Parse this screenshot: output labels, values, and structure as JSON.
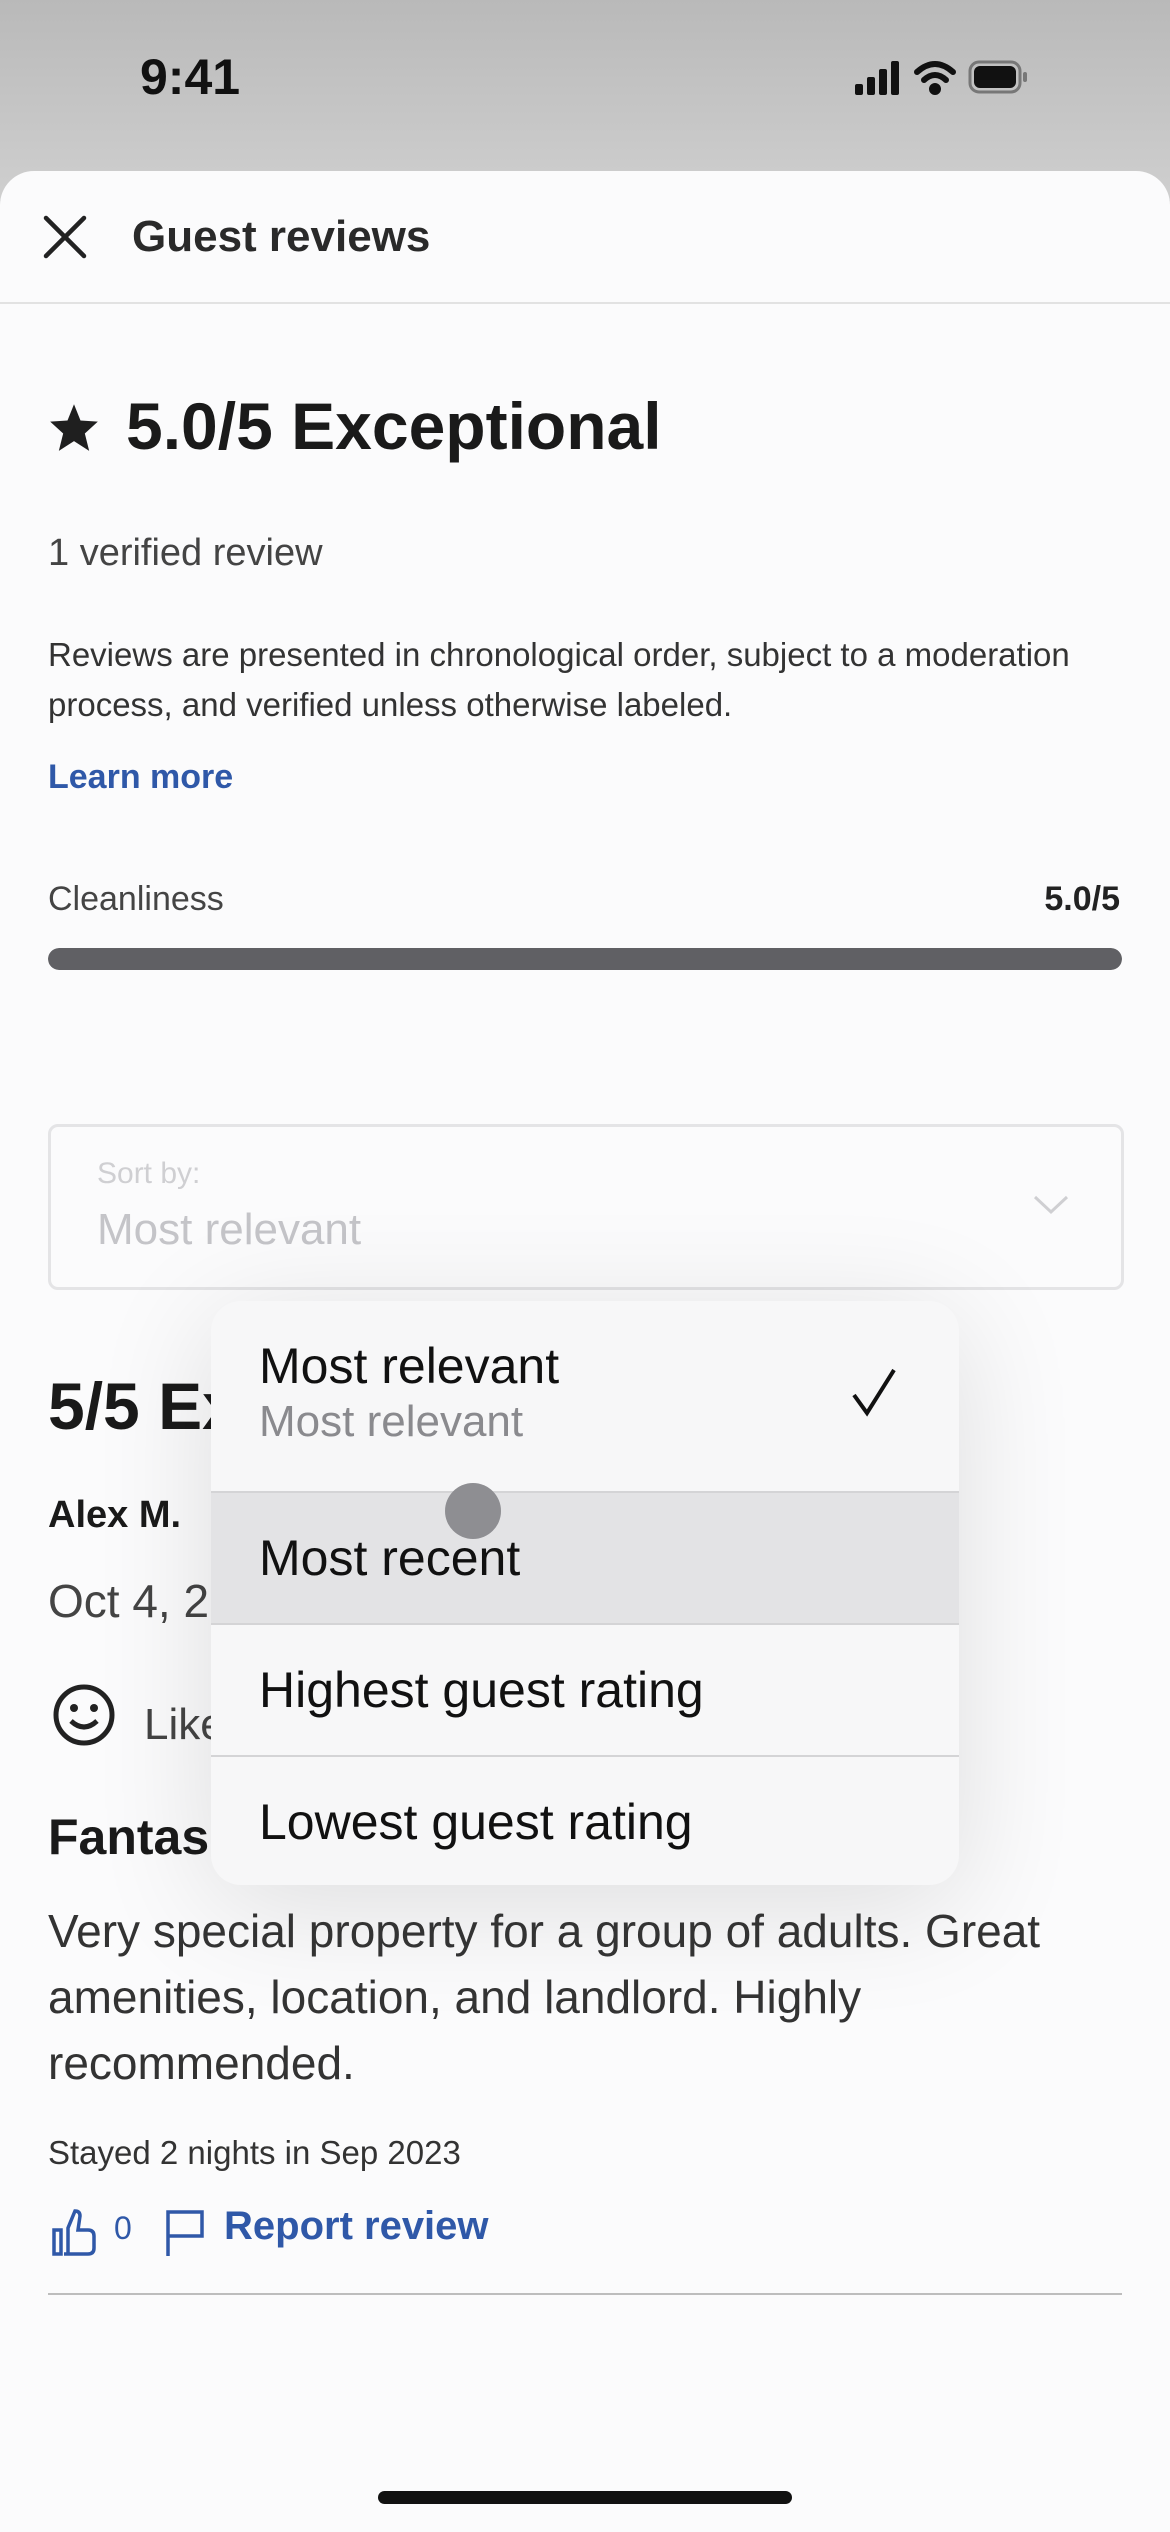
{
  "status_bar": {
    "time": "9:41"
  },
  "header": {
    "title": "Guest reviews",
    "close_icon": "close-icon"
  },
  "summary": {
    "rating_title": "5.0/5 Exceptional",
    "verified_count": "1 verified review",
    "disclaimer": "Reviews are presented in chronological order, subject to a moderation process, and verified unless otherwise labeled.",
    "learn_more": "Learn more",
    "categories": [
      {
        "label": "Cleanliness",
        "value": "5.0/5",
        "fraction": 1.0
      }
    ]
  },
  "sort": {
    "label": "Sort by:",
    "value": "Most relevant"
  },
  "sort_menu": {
    "items": [
      {
        "label": "Most relevant",
        "subtitle": "Most relevant",
        "selected": true
      },
      {
        "label": "Most recent",
        "highlighted": true
      },
      {
        "label": "Highest guest rating"
      },
      {
        "label": "Lowest guest rating"
      }
    ]
  },
  "review": {
    "rating_partial": "5/5 Ex",
    "author": "Alex M.",
    "date_partial": "Oct 4, 2",
    "liked_partial": "Like",
    "title_partial": "Fantas",
    "body": "Very special property for a group of adults. Great amenities, location, and landlord. Highly recommended.",
    "stay": "Stayed 2 nights in Sep 2023",
    "helpful_count": "0",
    "report": "Report review"
  },
  "colors": {
    "link": "#2f58a8",
    "bar": "#606064"
  }
}
